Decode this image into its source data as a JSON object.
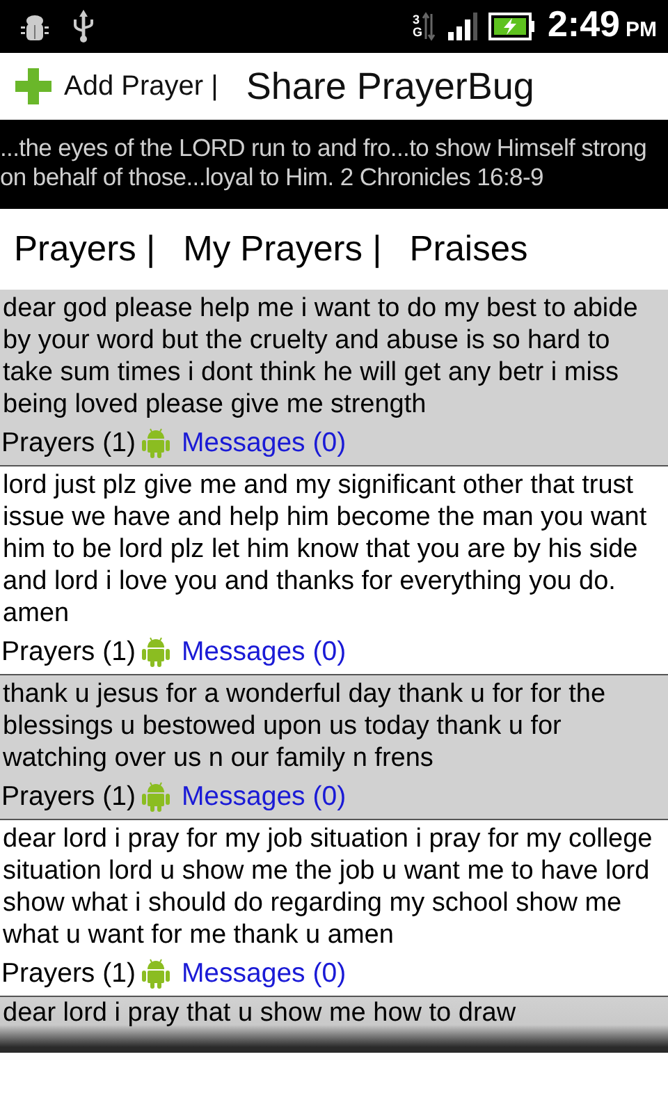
{
  "status_bar": {
    "time": "2:49",
    "ampm": "PM",
    "network": "3G"
  },
  "header": {
    "add_label": "Add Prayer |",
    "share_label": "Share PrayerBug"
  },
  "verse": "...the eyes of the LORD run to and fro...to show Himself strong on behalf of those...loyal to Him. 2 Chronicles 16:8-9",
  "tabs": [
    {
      "label": "Prayers |"
    },
    {
      "label": "My Prayers |"
    },
    {
      "label": "Praises"
    }
  ],
  "prayers": [
    {
      "text": "dear god please help me i want to do my best to abide by your word but the cruelty and abuse is so hard to take sum times i dont think he will get any betr   i miss being loved please give me strength",
      "prayers_count": "Prayers (1)",
      "messages": "Messages (0)"
    },
    {
      "text": "lord just plz give me and my significant other that trust issue we have and help him become the man you want him to be lord plz let him know that you are by his side and lord i love you and thanks for everything you do. amen",
      "prayers_count": "Prayers (1)",
      "messages": "Messages (0)"
    },
    {
      "text": "thank u jesus for a wonderful day thank u for for the blessings u bestowed upon us today thank u for watching over us n our family n frens",
      "prayers_count": "Prayers (1)",
      "messages": "Messages (0)"
    },
    {
      "text": "dear lord i pray for my job situation i pray for my college situation lord u show me the job u want me to have lord show what i should do regarding my school show me what u want for me thank u amen",
      "prayers_count": "Prayers (1)",
      "messages": "Messages (0)"
    },
    {
      "text": "dear lord i pray that u show me how to draw"
    }
  ]
}
